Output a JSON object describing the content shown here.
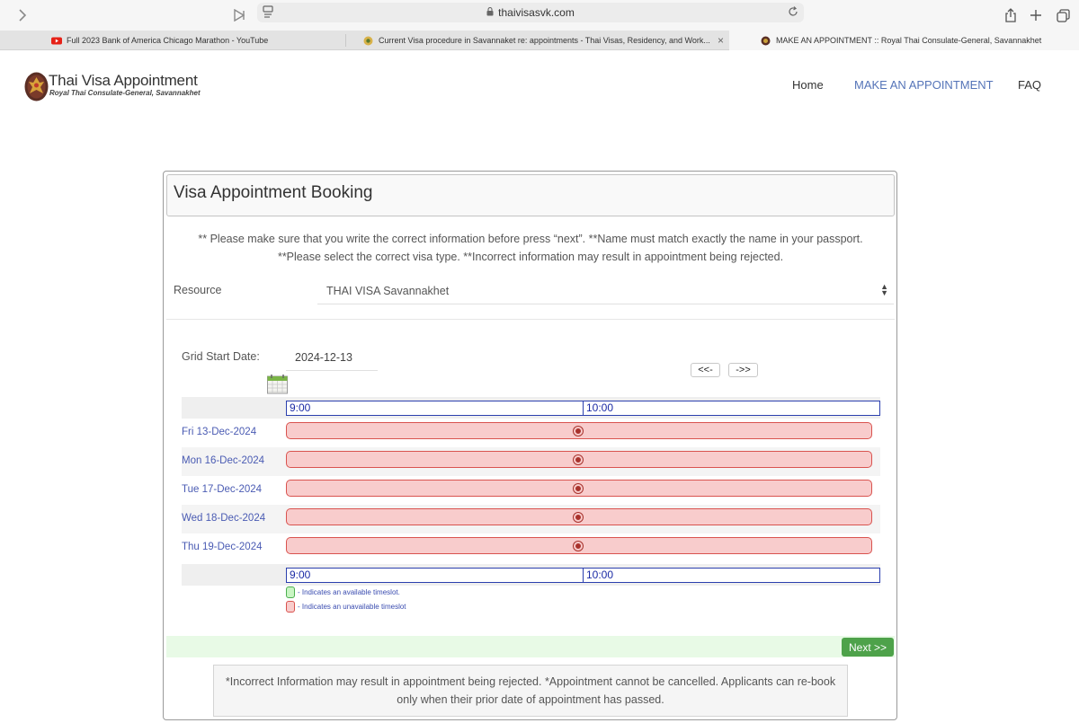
{
  "browser": {
    "url": "thaivisasvk.com",
    "tabs": [
      {
        "title": "Full 2023 Bank of America Chicago Marathon - YouTube",
        "icon": "youtube-icon"
      },
      {
        "title": "Current Visa procedure in Savannaket re: appointments - Thai Visas, Residency, and Work...",
        "icon": "forum-icon"
      },
      {
        "title": "MAKE AN APPOINTMENT :: Royal Thai Consulate-General, Savannakhet",
        "icon": "garuda-icon"
      }
    ]
  },
  "site": {
    "brand_title": "Thai Visa Appointment",
    "brand_subtitle": "Royal Thai Consulate-General, Savannakhet",
    "nav": [
      {
        "label": "Home"
      },
      {
        "label": "MAKE AN APPOINTMENT"
      },
      {
        "label": "FAQ"
      }
    ]
  },
  "booking": {
    "title": "Visa Appointment Booking",
    "notice_line1": "** Please make sure that you write the correct information before press “next”. **Name must match exactly the name in your passport.",
    "notice_line2": "**Please select the correct visa type. **Incorrect information may result in appointment being rejected.",
    "resource_label": "Resource",
    "resource_value": "THAI VISA Savannakhet",
    "grid_start_label": "Grid Start Date:",
    "grid_start_value": "2024-12-13",
    "prev_label": "<<-",
    "next_label": "->>",
    "times": [
      "9:00",
      "10:00"
    ],
    "days": [
      {
        "label": "Fri 13-Dec-2024",
        "available": false
      },
      {
        "label": "Mon 16-Dec-2024",
        "available": false
      },
      {
        "label": "Tue 17-Dec-2024",
        "available": false
      },
      {
        "label": "Wed 18-Dec-2024",
        "available": false
      },
      {
        "label": "Thu 19-Dec-2024",
        "available": false
      }
    ],
    "legend_available": "- Indicates an available timeslot.",
    "legend_unavailable": "- Indicates an unavailable timeslot",
    "legend_colors": {
      "available": "#c9f5c3",
      "available_border": "#4caf50",
      "unavailable": "#f8cccc",
      "unavailable_border": "#d9534f"
    },
    "next_button": "Next >>",
    "footer_note": "*Incorrect Information may result in appointment being rejected. *Appointment cannot be cancelled. Applicants can re-book only when their prior date of appointment has passed."
  },
  "colors": {
    "accent": "#5574b8",
    "next_green": "#4ea24a",
    "grid_blue": "#2b3fae"
  }
}
